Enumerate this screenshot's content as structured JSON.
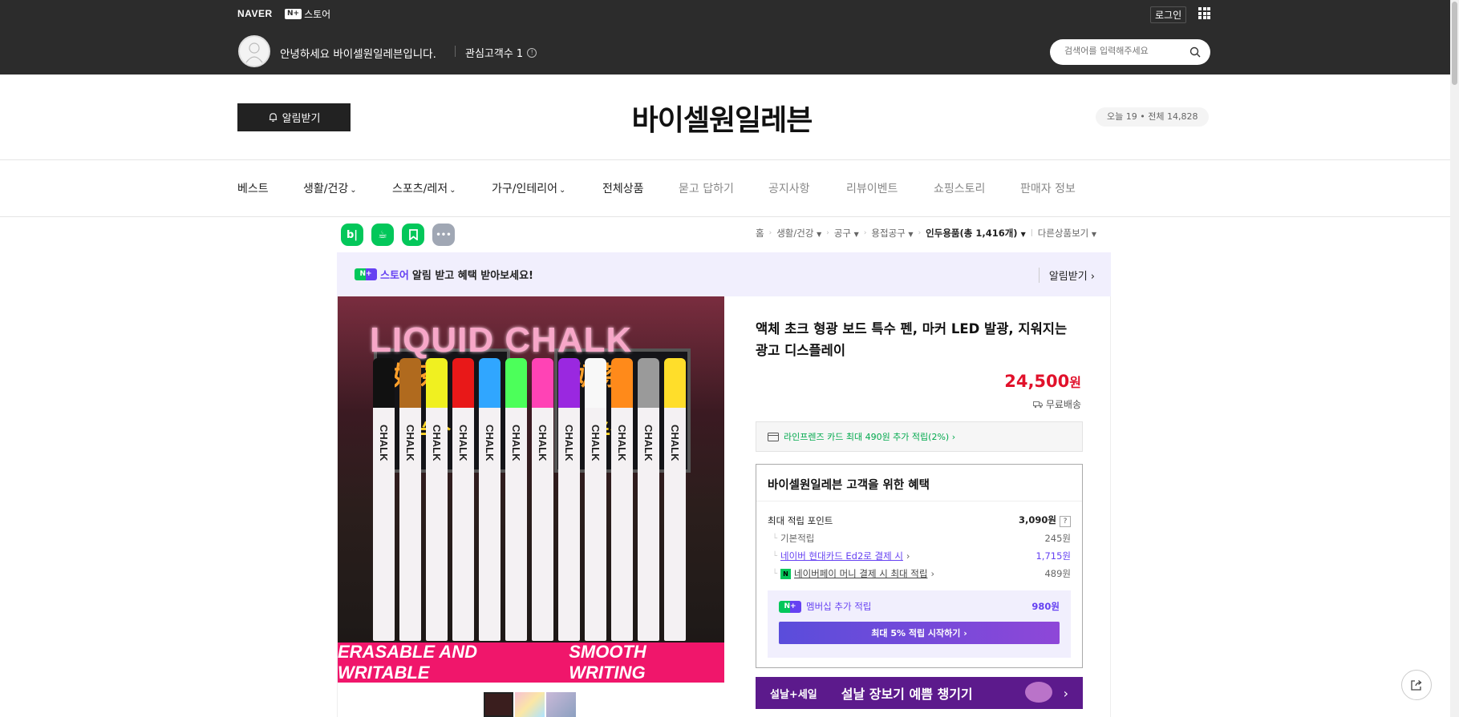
{
  "topbar": {
    "naver_logo": "NAVER",
    "store_badge": "N+",
    "store_label": "스토어",
    "login": "로그인",
    "greeting": "안녕하세요 바이셀원일레븐입니다.",
    "fans_label": "관심고객수 1",
    "search_placeholder": "검색어를 입력해주세요"
  },
  "header": {
    "notify_button": "알림받기",
    "store_name": "바이셀원일레븐",
    "visitor": "오늘 19 • 전체 14,828"
  },
  "nav": {
    "items": [
      {
        "label": "베스트"
      },
      {
        "label": "생활/건강"
      },
      {
        "label": "스포츠/레저"
      },
      {
        "label": "가구/인테리어"
      },
      {
        "label": "전체상품"
      },
      {
        "label": "묻고 답하기"
      },
      {
        "label": "공지사항"
      },
      {
        "label": "리뷰이벤트"
      },
      {
        "label": "쇼핑스토리"
      },
      {
        "label": "판매자 정보"
      }
    ]
  },
  "social": {
    "blog": "b|",
    "talk": "☕",
    "bookmark": "",
    "more": "•••"
  },
  "breadcrumb": {
    "items": [
      "홈",
      "생활/건강",
      "공구",
      "용접공구"
    ],
    "current": "인두용품(총 1,416개)",
    "other": "다른상품보기"
  },
  "promo": {
    "badge": "N+",
    "store": "스토어",
    "text": "알림 받고 혜택 받아보세요!",
    "action": "알림받기 ›"
  },
  "product": {
    "image_title": "LIQUID CHALK",
    "board_text_1": "奶茶",
    "board_text_2": "奶茶",
    "marker_label": "CHALK",
    "image_banner_left": "ERASABLE AND WRITABLE",
    "image_banner_right": "SMOOTH WRITING",
    "title": "액체 초크 형광 보드 특수 펜, 마커 LED 발광, 지워지는 광고 디스플레이",
    "price_value": "24,500",
    "price_unit": "원",
    "shipping": "무료배송",
    "card_benefit": "라인프렌즈 카드 최대 490원 추가 적립(2%) ›"
  },
  "benefit": {
    "title": "바이셀원일레븐 고객을 위한 혜택",
    "max_label": "최대 적립 포인트",
    "max_value": "3,090원",
    "help": "?",
    "basic_label": "기본적립",
    "basic_value": "245원",
    "card_label": "네이버 현대카드 Ed2로 결제 시",
    "card_value": "1,715원",
    "npay_label": "네이버페이 머니 결제 시 최대 적립",
    "npay_value": "489원",
    "npay_icon": "N",
    "member_badge": "N+",
    "member_label": "멤버십 추가 적립",
    "member_value": "980원",
    "member_button": "최대 5% 적립 시작하기 ›"
  },
  "event": {
    "tag": "설날+세일",
    "text": "설날 장보기 예쁨 챙기기",
    "arrow": "›"
  },
  "colors": {
    "accent": "#6541f2",
    "naver_green": "#03c75a",
    "price_red": "#e1112b",
    "topbar": "#2c2c2c"
  }
}
